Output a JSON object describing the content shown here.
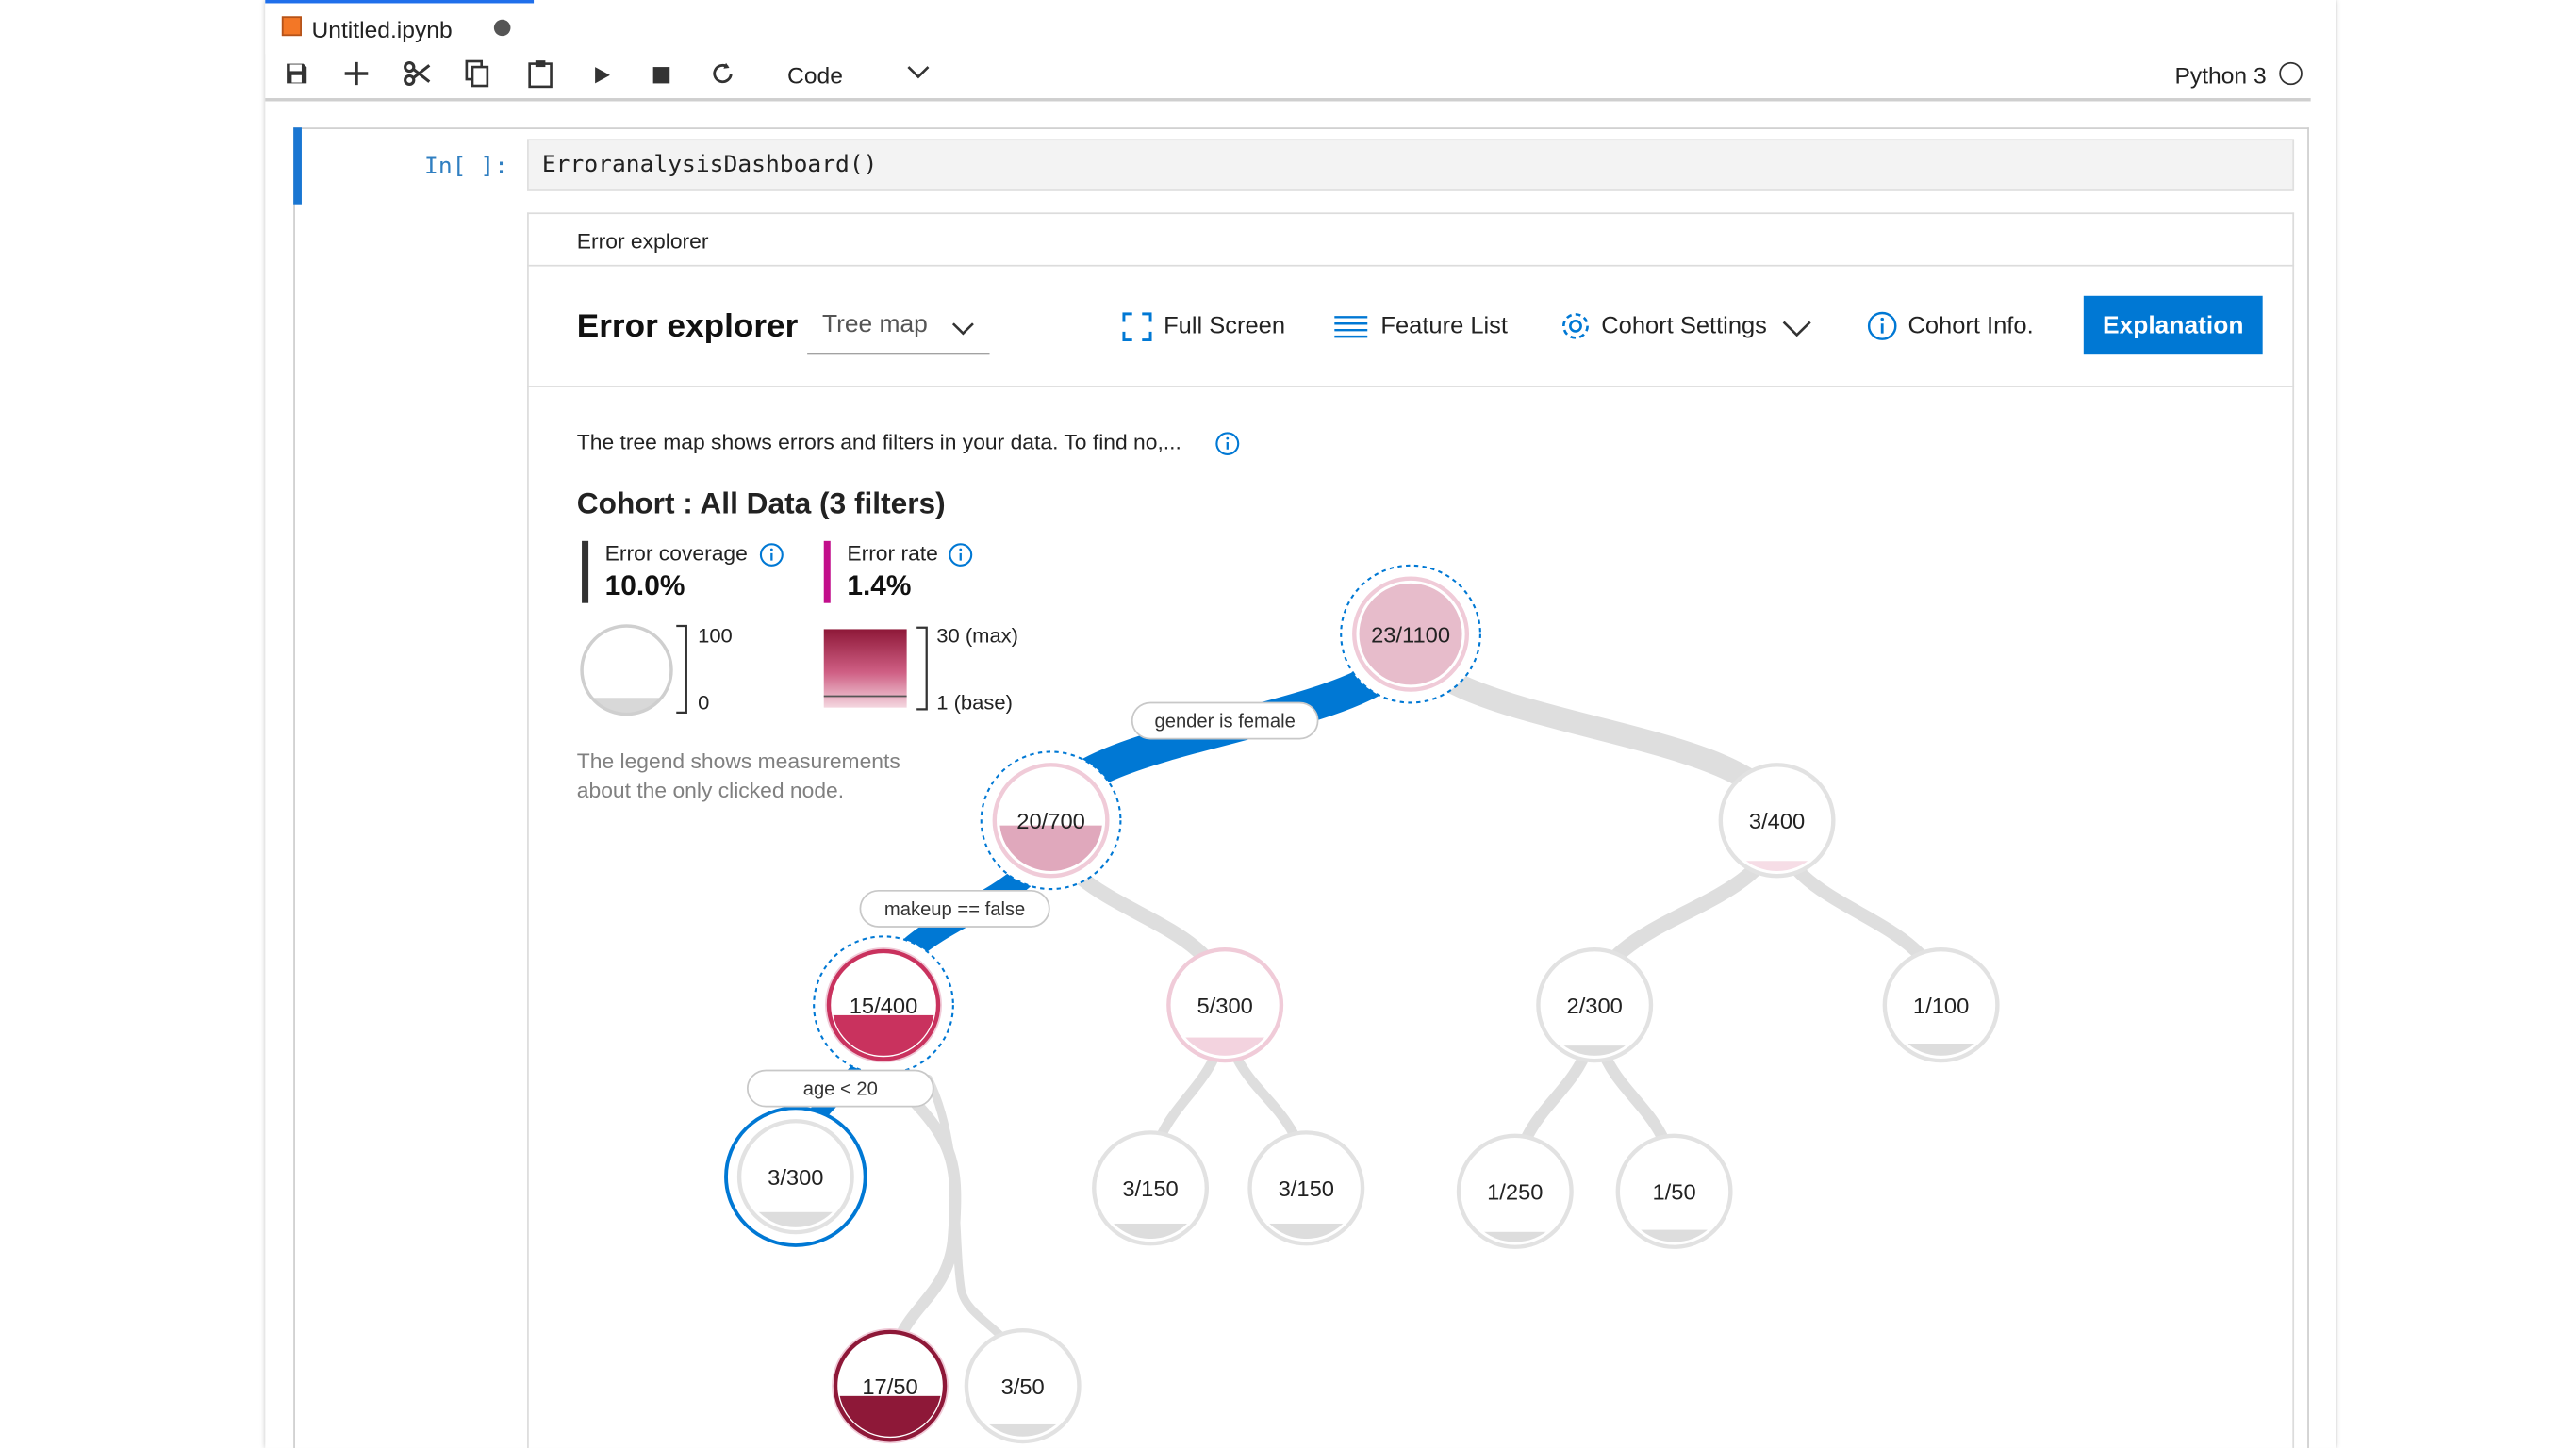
{
  "tab": {
    "title": "Untitled.ipynb"
  },
  "toolbar": {
    "cell_type": "Code",
    "kernel": "Python 3",
    "icons": [
      "save-icon",
      "add-icon",
      "cut-icon",
      "copy-icon",
      "paste-icon",
      "run-icon",
      "stop-icon",
      "restart-icon"
    ]
  },
  "cell": {
    "prompt": "In[ ]:",
    "code": "ErroranalysisDashboard()"
  },
  "dashboard": {
    "header_small": "Error explorer",
    "title": "Error explorer",
    "view_select": "Tree map",
    "full_screen": "Full Screen",
    "feature_list": "Feature List",
    "cohort_settings": "Cohort Settings",
    "cohort_info": "Cohort Info.",
    "explanation": "Explanation",
    "description": "The tree map shows errors and filters in your data. To find no,...",
    "cohort_title": "Cohort : All Data (3 filters)",
    "error_coverage_label": "Error coverage",
    "error_coverage_value": "10.0%",
    "error_rate_label": "Error rate",
    "error_rate_value": "1.4%",
    "coverage_max": "100",
    "coverage_min": "0",
    "rate_max": "30 (max)",
    "rate_min": "1 (base)",
    "legend_note": "The legend shows measurements about the only clicked node.",
    "colors": {
      "accent": "#0078d4",
      "error_rate": "#c20e8b",
      "coverage": "#333333"
    }
  },
  "tree": {
    "nodes": [
      {
        "id": "n0",
        "label": "23/1100",
        "fill": "#e7bccb",
        "error_fraction": 1.0,
        "selected": true
      },
      {
        "id": "n1",
        "label": "20/700",
        "fill": "#e0a8bc",
        "error_fraction": 0.45,
        "selected": true
      },
      {
        "id": "n2",
        "label": "3/400",
        "fill": "#f6dde6",
        "error_fraction": 0.1,
        "selected": false
      },
      {
        "id": "n3",
        "label": "15/400",
        "fill": "#c9325e",
        "error_fraction": 0.4,
        "selected": true
      },
      {
        "id": "n4",
        "label": "5/300",
        "fill": "#f3d3df",
        "error_fraction": 0.18,
        "selected": false
      },
      {
        "id": "n5",
        "label": "2/300",
        "fill": "#dddddd",
        "error_fraction": 0.1,
        "selected": false
      },
      {
        "id": "n6",
        "label": "1/100",
        "fill": "#dddddd",
        "error_fraction": 0.12,
        "selected": false
      },
      {
        "id": "n7",
        "label": "3/300",
        "fill": "#dddddd",
        "error_fraction": 0.15,
        "selected": false,
        "clicked": true
      },
      {
        "id": "n8",
        "label": "3/150",
        "fill": "#dddddd",
        "error_fraction": 0.15,
        "selected": false
      },
      {
        "id": "n9",
        "label": "3/150",
        "fill": "#dddddd",
        "error_fraction": 0.15,
        "selected": false
      },
      {
        "id": "n10",
        "label": "1/250",
        "fill": "#dddddd",
        "error_fraction": 0.1,
        "selected": false
      },
      {
        "id": "n11",
        "label": "1/50",
        "fill": "#dddddd",
        "error_fraction": 0.12,
        "selected": false
      },
      {
        "id": "n12",
        "label": "17/50",
        "fill": "#8e1838",
        "error_fraction": 0.4,
        "selected": false
      },
      {
        "id": "n13",
        "label": "3/50",
        "fill": "#dddddd",
        "error_fraction": 0.12,
        "selected": false
      }
    ],
    "edge_labels": [
      "gender is female",
      "makeup == false",
      "age < 20"
    ]
  }
}
